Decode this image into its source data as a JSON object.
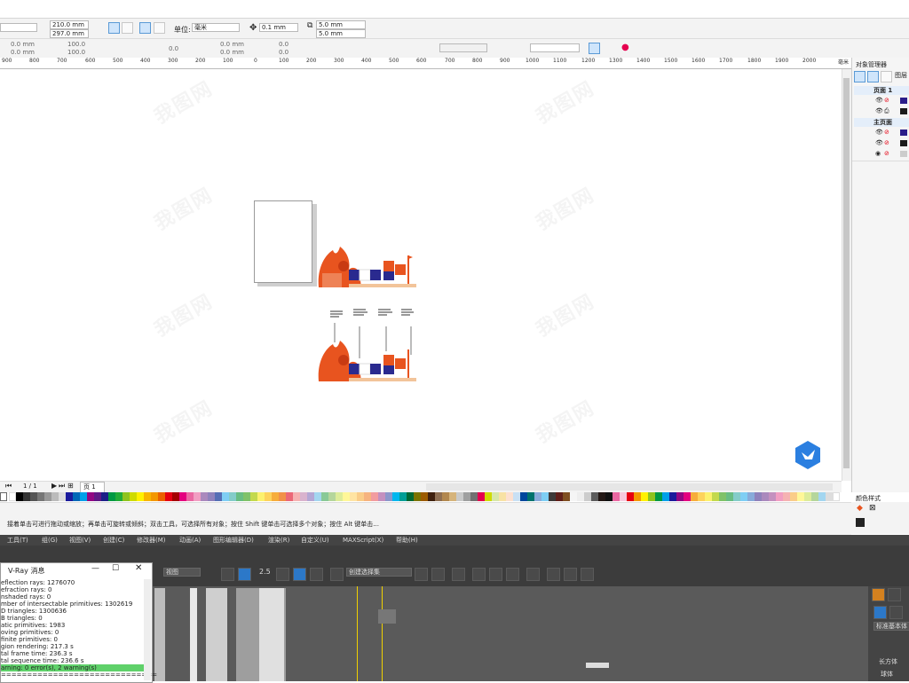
{
  "property_bar": {
    "width": "210.0 mm",
    "height": "297.0 mm",
    "units_label": "单位:",
    "units_value": "毫米",
    "nudge": "0.1 mm",
    "dup_x": "5.0 mm",
    "dup_y": "5.0 mm"
  },
  "prop_bar2": {
    "x": "0.0 mm",
    "y": "0.0 mm",
    "scale_x": "100.0",
    "scale_y": "100.0",
    "angle": "0.0",
    "pos_a": "0.0 mm",
    "pos_b": "0.0 mm",
    "val_a": "0.0",
    "val_b": "0.0"
  },
  "ruler": {
    "labels": [
      "900",
      "800",
      "700",
      "600",
      "500",
      "400",
      "300",
      "200",
      "100",
      "0",
      "100",
      "200",
      "300",
      "400",
      "500",
      "600",
      "700",
      "800",
      "900",
      "1000",
      "1100",
      "1200",
      "1300",
      "1400",
      "1500",
      "1600",
      "1700",
      "1800",
      "1900",
      "2000"
    ],
    "unit": "毫米"
  },
  "object_manager": {
    "title": "对象管理器",
    "layer_tab": "图层",
    "page1": "页面 1",
    "master": "主页面"
  },
  "color_styles": {
    "title": "颜色样式"
  },
  "page_nav": {
    "count": "1 / 1",
    "tab": "页 1"
  },
  "palette": [
    "#ffffff",
    "#000000",
    "#1b1b9c",
    "#00a0e9",
    "#009944",
    "#fff100",
    "#e60012",
    "#e4007f",
    "#f39800",
    "#8fc31f",
    "#c8e0f4",
    "#fce0d0",
    "#d7e7a8",
    "#f8e2a4",
    "#dddddd",
    "#b7b7b7",
    "#7d7d7d",
    "#595757",
    "#e5004f",
    "#920783",
    "#601986",
    "#1d2088",
    "#0068b7",
    "#00a0e9",
    "#009e96",
    "#009944",
    "#22ac38",
    "#8fc31f",
    "#cfdb00",
    "#fff100",
    "#f8b500",
    "#eb6100",
    "#e60012",
    "#a40000",
    "#ea68a2",
    "#f19ec2",
    "#f7c9dd",
    "#aa89bd",
    "#8f82bc",
    "#7fcef4",
    "#69bd83",
    "#80c269",
    "#c3d94e",
    "#fcf16e",
    "#fdd35c",
    "#f6ad3c",
    "#f19149",
    "#eb6877",
    "#f5b2b2",
    "#d9b3ce",
    "#b4a7d5",
    "#a3d6f0",
    "#89c997",
    "#b5d69c",
    "#ddec9a",
    "#fff799",
    "#ffe4a3",
    "#facd89",
    "#f6b37f",
    "#f29c9f",
    "#c490bf",
    "#8c97cb",
    "#84ccc9",
    "#00b7ee",
    "#7ecef4",
    "#88abda",
    "#556fb5",
    "#3e3a39",
    "#601f1a",
    "#7f4f21",
    "#8e6e52",
    "#b28850",
    "#d6b47b",
    "#c9caca",
    "#9fa0a0",
    "#727171",
    "#5d5d5d",
    "#40210f",
    "#231815",
    "#f5f5f5",
    "#eeeeee",
    "#cccccc",
    "#bbbbbb",
    "#999999",
    "#777777",
    "#555555",
    "#333333",
    "#111111",
    "#00479d",
    "#00736d",
    "#006934",
    "#7c7300",
    "#9c5b00"
  ],
  "status": {
    "hint": "接着单击可进行拖动或缩放；再单击可旋转或倾斜；双击工具，可选择所有对象；按住 Shift 键单击可选择多个对象；按住 Alt 键单击..."
  },
  "max_menu": [
    "工具(T)",
    "组(G)",
    "视图(V)",
    "创建(C)",
    "修改器(M)",
    "动画(A)",
    "图形编辑器(D)",
    "渲染(R)",
    "自定义(U)",
    "MAXScript(X)",
    "帮助(H)"
  ],
  "max_toolbar": {
    "view": "视图",
    "snap": "2.5",
    "selection_set": "创建选择集"
  },
  "vray": {
    "title": "V-Ray 消息",
    "lines": [
      "eflection rays: 1276070",
      "efraction rays: 0",
      "nshaded rays: 0",
      "mber of intersectable primitives: 1302619",
      "D triangles: 1300636",
      "B triangles: 0",
      "atic primitives: 1983",
      "oving primitives: 0",
      "finite primitives: 0",
      "gion rendering: 217.3 s",
      "tal frame time: 236.3 s",
      "tal sequence time: 236.6 s",
      "arning: 0 error(s), 2 warning(s)",
      "=============================="
    ]
  },
  "max_right": {
    "std_prims": "标准基本体",
    "box": "长方体",
    "sphere": "球体"
  },
  "watermark": "我图网"
}
